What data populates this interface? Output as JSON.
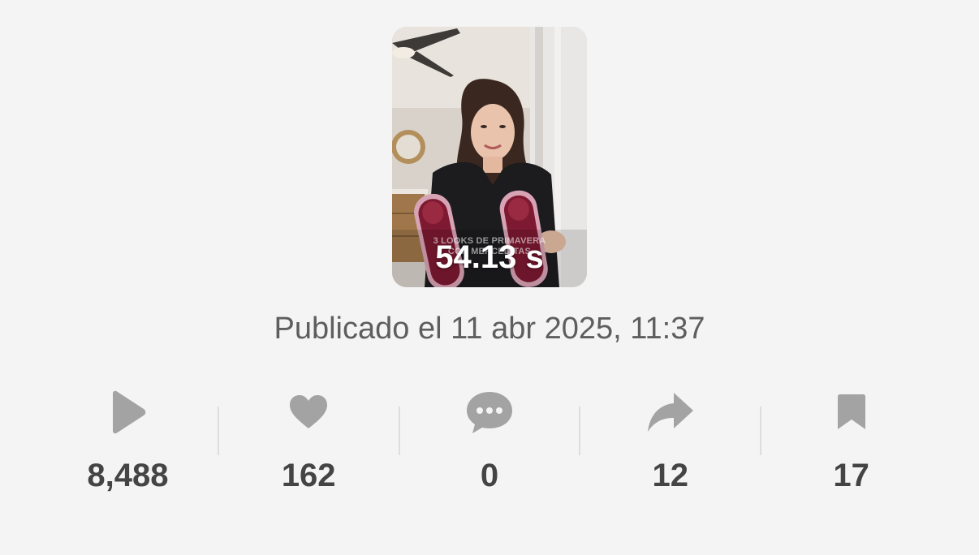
{
  "video": {
    "duration": "54.13 s",
    "caption_line1": "3 LOOKS DE PRIMAVERA",
    "caption_line2": "CON MERCEDITAS"
  },
  "published": "Publicado el 11 abr 2025, 11:37",
  "colors": {
    "background": "#f4f4f4",
    "icon": "#a3a3a3",
    "value_text": "#444444",
    "published_text": "#5e5e5e"
  },
  "stats": [
    {
      "icon": "play-icon",
      "value": "8,488"
    },
    {
      "icon": "heart-icon",
      "value": "162"
    },
    {
      "icon": "comment-icon",
      "value": "0"
    },
    {
      "icon": "share-icon",
      "value": "12"
    },
    {
      "icon": "bookmark-icon",
      "value": "17"
    }
  ]
}
